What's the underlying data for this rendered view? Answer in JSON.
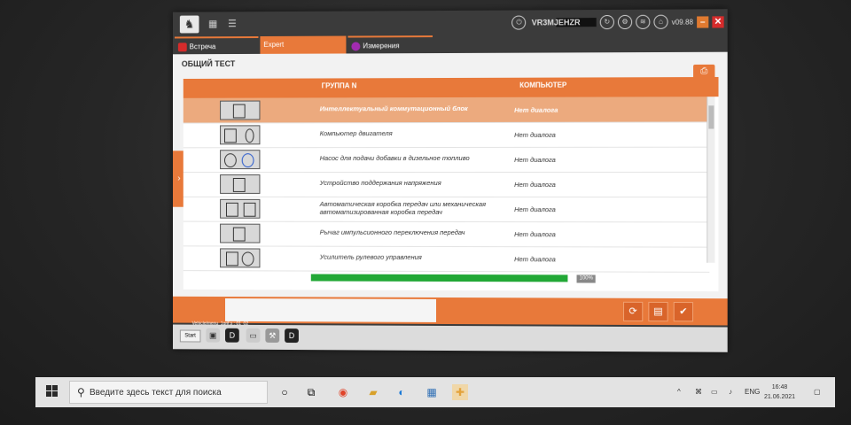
{
  "header": {
    "vin": "VR3MJEHZR",
    "version": "v09.88",
    "min_label": "–",
    "close_label": "✕"
  },
  "tabs": [
    {
      "label": "Встреча"
    },
    {
      "label": "Expert"
    },
    {
      "label": "Измерения"
    }
  ],
  "page": {
    "title": "ОБЩИЙ ТЕСТ"
  },
  "table": {
    "columns": [
      "ГРУППА N",
      "КОМПЬЮТЕР"
    ],
    "rows": [
      {
        "name": "Интеллектуальный коммутационный блок",
        "status": "Нет диалога",
        "selected": true
      },
      {
        "name": "Компьютер двигателя",
        "status": "Нет диалога"
      },
      {
        "name": "Насос для подачи добавки в дизельное топливо",
        "status": "Нет диалога"
      },
      {
        "name": "Устройство поддержания напряжения",
        "status": "Нет диалога"
      },
      {
        "name": "Автоматическая коробка передач или механическая автоматизированная коробка передач",
        "status": "Нет диалога"
      },
      {
        "name": "Рычаг импульсионного переключения передач",
        "status": "Нет диалога"
      },
      {
        "name": "Усилитель рулевого управления",
        "status": "Нет диалога"
      }
    ]
  },
  "progress": {
    "value": 1.0,
    "label": "100%"
  },
  "footer": {
    "vehicle_label": "Vehicle/menu_1grif.s : 01_02"
  },
  "innerbar": {
    "start_label": "Start"
  },
  "taskbar": {
    "search_placeholder": "Введите здесь текст для поиска",
    "language": "ENG",
    "time": "16:48",
    "date": "21.06.2021"
  },
  "colors": {
    "accent": "#e8793a",
    "progress": "#22a836",
    "close": "#d62b2b"
  }
}
